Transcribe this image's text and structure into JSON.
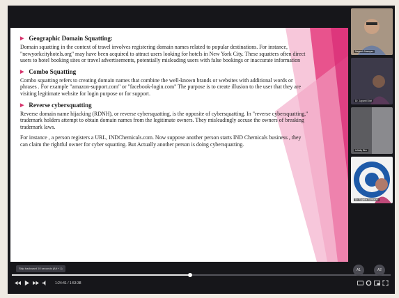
{
  "slide": {
    "sections": [
      {
        "heading": "Geographic Domain Squatting:",
        "paragraphs": [
          "Domain squatting in the context of travel involves registering domain names related to popular destinations. For instance, \"newyorkcityhotels.org\" may have been acquired to attract users looking for hotels in New York City. These squatters often direct users to hotel booking sites or travel advertisements, potentially misleading users with false bookings or inaccurate information"
        ]
      },
      {
        "heading": "Combo Squatting",
        "paragraphs": [
          "Combo squatting refers to creating domain names that combine the well-known brands or websites with additional words or phrases . For example \"amazon-support.com\" or \"facebook-login.com\" The purpose is to create illusion to the user that they are visiting legitimate website for login purpose or for support."
        ]
      },
      {
        "heading": "Reverse cybersquatting",
        "paragraphs": [
          "Reverse domain name hijacking (RDNH), or reverse cybersquatting, is the opposite of cybersquatting. In \"reverse cybersquatting,\" trademark holders attempt to obtain domain names from the legitimate owners. They misleadingly accuse the owners of breaking trademark laws.",
          "For instance , a person registers a URL, INDChemicals.com. Now suppose another person starts IND Chemicals business , they can claim the rightful owner for cyber squatting. But Actually another person is doing cybersquatting."
        ]
      }
    ]
  },
  "participants": [
    {
      "name": "Nagesh Narayan"
    },
    {
      "name": "Dr. Jayanti Dixit"
    },
    {
      "name": "Infinity Bim"
    },
    {
      "name": "Dr. Sujatha Subbarao"
    }
  ],
  "player": {
    "toast": "Skip backward 10 seconds (Alt + J)",
    "time": "1:24:41 / 1:53:38",
    "progress_fraction": 0.47,
    "buttons": [
      {
        "label": "A1"
      },
      {
        "label": "A2"
      }
    ]
  },
  "colors": {
    "accent": "#e0437f",
    "accent_light": "#f3a6c6",
    "background": "#16161a"
  }
}
